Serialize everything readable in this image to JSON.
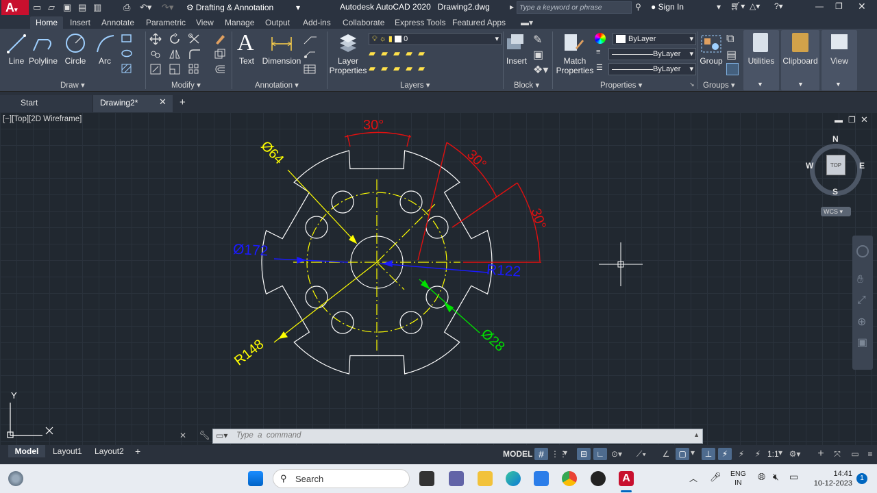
{
  "titlebar": {
    "workspace": "Drafting & Annotation",
    "title": "Autodesk AutoCAD 2020   Drawing2.dwg",
    "search_placeholder": "Type a keyword or phrase",
    "sign_in": "Sign In"
  },
  "ribbon_tabs": [
    "Home",
    "Insert",
    "Annotate",
    "Parametric",
    "View",
    "Manage",
    "Output",
    "Add-ins",
    "Collaborate",
    "Express Tools",
    "Featured Apps"
  ],
  "draw": {
    "line": "Line",
    "polyline": "Polyline",
    "circle": "Circle",
    "arc": "Arc",
    "panel": "Draw ▾"
  },
  "modify": {
    "panel": "Modify ▾"
  },
  "annotation": {
    "text": "Text",
    "dimension": "Dimension",
    "panel": "Annotation ▾"
  },
  "layers": {
    "layer_properties": "Layer\nProperties",
    "current_layer": "0",
    "panel": "Layers ▾"
  },
  "block": {
    "insert": "Insert",
    "panel": "Block ▾"
  },
  "properties": {
    "match": "Match\nProperties",
    "color": "ByLayer",
    "linetype": "ByLayer",
    "lineweight": "ByLayer",
    "panel": "Properties ▾"
  },
  "groups": {
    "group": "Group",
    "panel": "Groups ▾"
  },
  "utilities": "Utilities",
  "clipboard": "Clipboard",
  "view": "View",
  "doc_tabs": {
    "start": "Start",
    "drawing": "Drawing2*"
  },
  "viewport_label": "[−][Top][2D Wireframe]",
  "viewcube": {
    "n": "N",
    "s": "S",
    "e": "E",
    "w": "W",
    "top": "TOP",
    "wcs": "WCS"
  },
  "ucs": {
    "x": "X",
    "y": "Y"
  },
  "dims": {
    "ang_top": "30°",
    "ang_right1": "30°",
    "ang_right2": "30°",
    "d64": "Ø64",
    "d172": "Ø172",
    "r122": "R122",
    "r148": "R148",
    "d28": "Ø28"
  },
  "command": {
    "placeholder": "Type  a  command"
  },
  "layout_tabs": [
    "Model",
    "Layout1",
    "Layout2"
  ],
  "status": {
    "model": "MODEL",
    "scale": "1:1"
  },
  "taskbar": {
    "search": "Search",
    "lang1": "ENG",
    "lang2": "IN",
    "time": "14:41",
    "date": "10-12-2023",
    "notif": "1"
  },
  "colors": {
    "white": "#ffffff",
    "yellow": "#ffff00",
    "red": "#e11010",
    "blue": "#1a1aff",
    "green": "#00e000"
  }
}
